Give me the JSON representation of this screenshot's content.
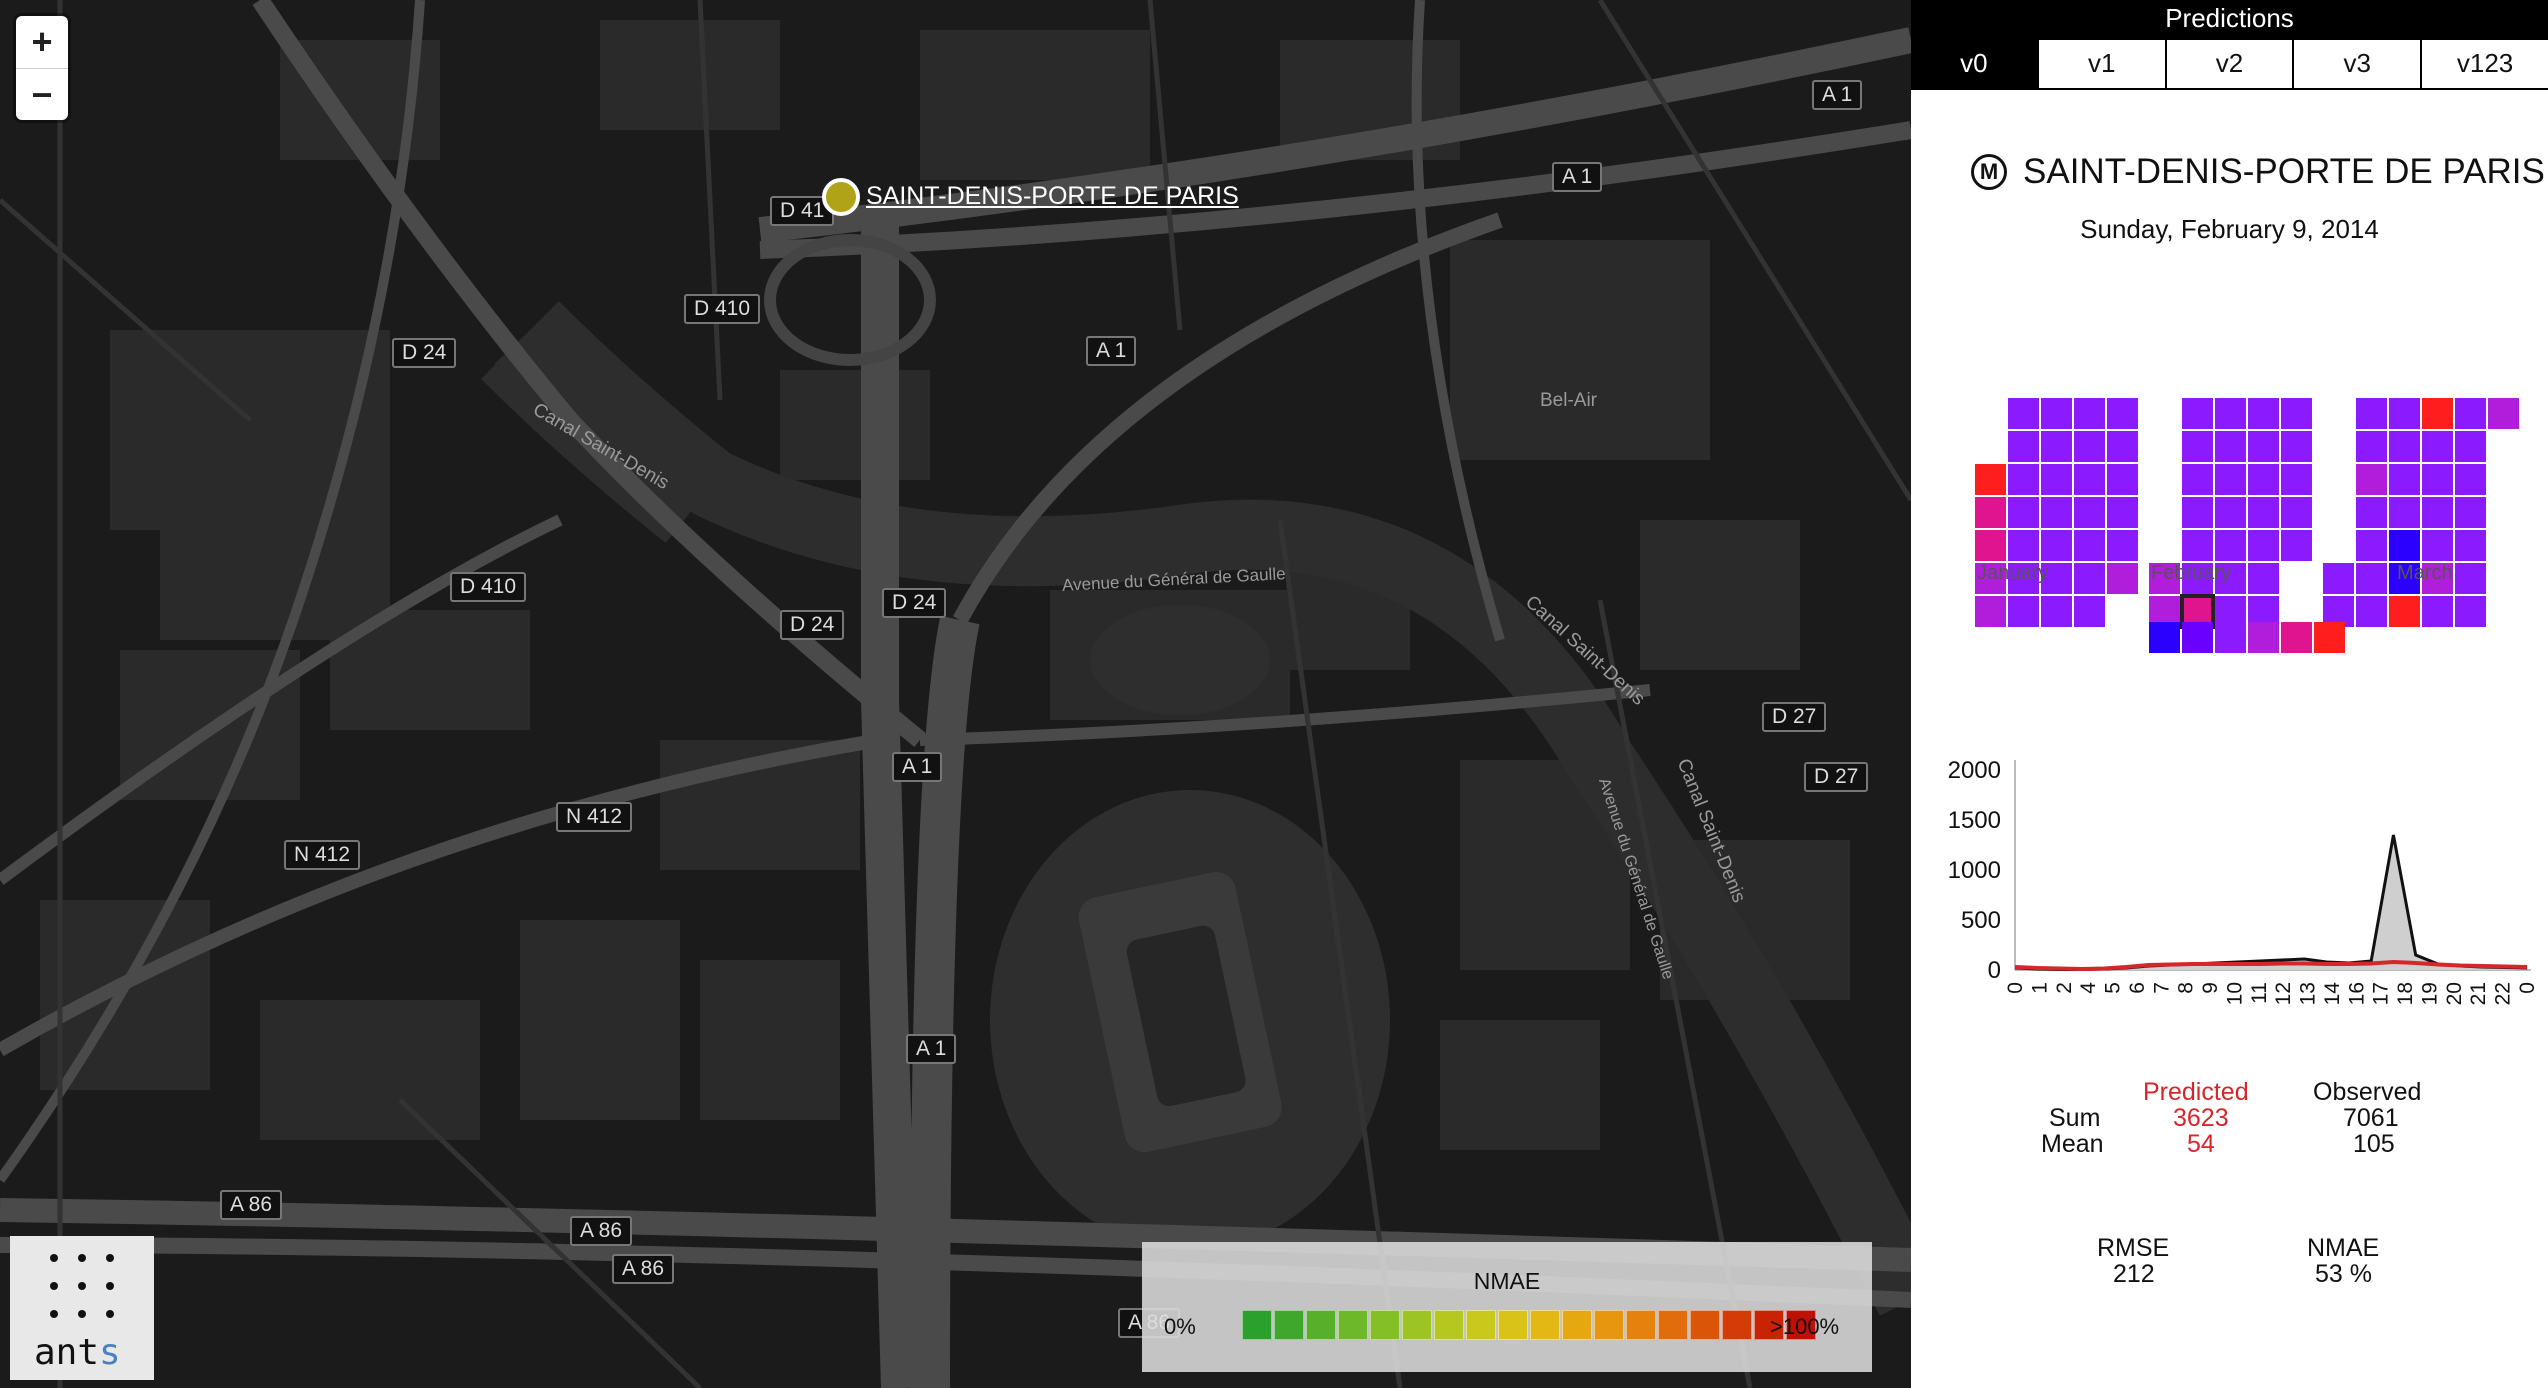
{
  "map": {
    "zoom_in": "+",
    "zoom_out": "−",
    "station": {
      "name": "SAINT-DENIS-PORTE DE PARIS",
      "marker_color": "#b0a317"
    },
    "road_labels": [
      "D 41",
      "D 410",
      "D 24",
      "A 1",
      "A 1",
      "A 1",
      "D 410",
      "D 24",
      "D 24",
      "A 1",
      "N 412",
      "N 412",
      "A 1",
      "D 27",
      "D 27",
      "A 86",
      "A 86",
      "A 86",
      "A 86"
    ],
    "place_labels": [
      "Canal Saint-Denis",
      "Bel-Air",
      "Avenue du Général de Gaulle",
      "Canal Saint-Denis",
      "Avenue du Général de Gaulle",
      "Canal Saint-Denis"
    ],
    "logo_text": {
      "main": "ant",
      "accent": "s"
    },
    "legend": {
      "title": "NMAE",
      "low": "0%",
      "high": ">100%",
      "colors": [
        "#2ca02c",
        "#3fa72b",
        "#58b02a",
        "#6cb828",
        "#84bf26",
        "#9cc524",
        "#b4c820",
        "#c9c81c",
        "#d9c318",
        "#e3b814",
        "#e6a811",
        "#e7960f",
        "#e5820d",
        "#e16c0b",
        "#db5509",
        "#d33c07",
        "#c92305",
        "#c00f03"
      ]
    }
  },
  "panel": {
    "header": "Predictions",
    "tabs": [
      "v0",
      "v1",
      "v2",
      "v3",
      "v123"
    ],
    "active_tab": "v0",
    "station_title": "SAINT-DENIS-PORTE DE PARIS",
    "metro_icon": "M",
    "date": "Sunday, February 9, 2014",
    "months": [
      "January",
      "February",
      "March"
    ],
    "color_scale": [
      "#2b00ff",
      "#6a00ff",
      "#8b1aff",
      "#b01ddb",
      "#e0148f",
      "#ff1e1e"
    ],
    "stats": {
      "predicted_label": "Predicted",
      "observed_label": "Observed",
      "sum_label": "Sum",
      "mean_label": "Mean",
      "predicted_sum": "3623",
      "observed_sum": "7061",
      "predicted_mean": "54",
      "observed_mean": "105",
      "rmse_label": "RMSE",
      "rmse_value": "212",
      "nmae_label": "NMAE",
      "nmae_value": "53 %"
    }
  },
  "chart_data": {
    "type": "area",
    "x": [
      "0",
      "1",
      "2",
      "3",
      "4",
      "5",
      "6",
      "7",
      "8",
      "9",
      "10",
      "11",
      "12",
      "13",
      "14",
      "15",
      "16",
      "17",
      "18",
      "19",
      "20",
      "21",
      "22",
      "23"
    ],
    "x_tick_labels": [
      "0",
      "1",
      "2",
      "4",
      "5",
      "6",
      "7",
      "8",
      "9",
      "10",
      "11",
      "12",
      "13",
      "14",
      "16",
      "17",
      "18",
      "19",
      "20",
      "21",
      "22",
      "0"
    ],
    "series": [
      {
        "values": [
          20,
          10,
          5,
          5,
          10,
          20,
          40,
          50,
          60,
          70,
          80,
          90,
          100,
          110,
          80,
          70,
          90,
          1350,
          150,
          60,
          40,
          30,
          25,
          20
        ]
      },
      {
        "values": [
          30,
          20,
          15,
          10,
          15,
          30,
          50,
          55,
          60,
          60,
          60,
          60,
          65,
          65,
          60,
          60,
          65,
          80,
          70,
          55,
          45,
          40,
          35,
          30
        ]
      }
    ],
    "series_colors": [
      "#111111",
      "#d6262b"
    ],
    "ylim": [
      0,
      2000
    ],
    "yticks": [
      0,
      500,
      1000,
      1500,
      2000
    ]
  }
}
